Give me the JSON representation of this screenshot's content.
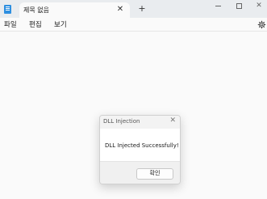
{
  "tab": {
    "title": "제목 없음",
    "close_glyph": "✕",
    "new_tab_glyph": "+"
  },
  "window_controls": {
    "minimize_icon": "minimize-icon",
    "maximize_icon": "maximize-icon",
    "close_glyph": "✕"
  },
  "menu": {
    "file": "파일",
    "edit": "편집",
    "view": "보기"
  },
  "dialog": {
    "title": "DLL Injection",
    "close_glyph": "✕",
    "message": "DLL Injected Successfully!",
    "ok_label": "확인"
  },
  "icons": {
    "app": "notepad-icon",
    "settings": "gear-icon"
  },
  "colors": {
    "accent": "#2d8fe0",
    "background": "#fafafa",
    "titlebar": "#e9ecef"
  }
}
